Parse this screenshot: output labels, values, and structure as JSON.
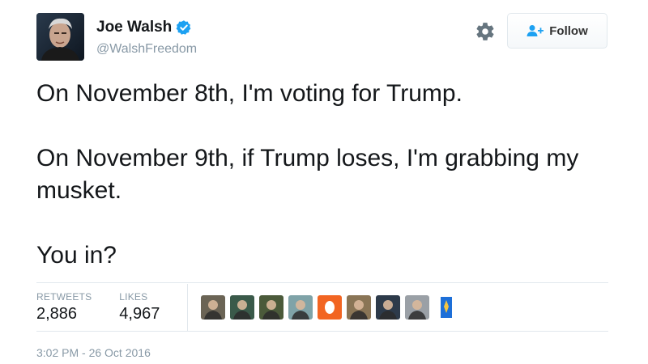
{
  "user": {
    "name": "Joe Walsh",
    "handle": "@WalshFreedom",
    "verified": true,
    "avatar_icon": "profile-photo"
  },
  "actions": {
    "settings_icon": "gear-icon",
    "follow_label": "Follow",
    "follow_icon": "add-user-icon"
  },
  "tweet": {
    "lines": [
      "On November 8th, I'm voting for Trump.",
      "On November 9th, if Trump loses, I'm grabbing my musket.",
      "You in?"
    ]
  },
  "stats": {
    "retweets_label": "RETWEETS",
    "retweets_value": "2,886",
    "likes_label": "LIKES",
    "likes_value": "4,967"
  },
  "likers": [
    {
      "icon": "liker-avatar-1",
      "color": "#6b6455"
    },
    {
      "icon": "liker-avatar-2",
      "color": "#3a5a4a"
    },
    {
      "icon": "liker-avatar-3",
      "color": "#4b5a3a"
    },
    {
      "icon": "liker-avatar-4",
      "color": "#7fa3a8"
    },
    {
      "icon": "liker-avatar-5",
      "color": "#f26522"
    },
    {
      "icon": "liker-avatar-6",
      "color": "#8a7556"
    },
    {
      "icon": "liker-avatar-7",
      "color": "#2d3a4a"
    },
    {
      "icon": "liker-avatar-8",
      "color": "#9aa0a6"
    },
    {
      "icon": "liker-avatar-9",
      "color": "#1d6fd8"
    }
  ],
  "timestamp": "3:02 PM - 26 Oct 2016",
  "colors": {
    "verified": "#1da1f2",
    "muted": "#8899a6",
    "text": "#14171a",
    "follow_icon": "#1da1f2"
  }
}
